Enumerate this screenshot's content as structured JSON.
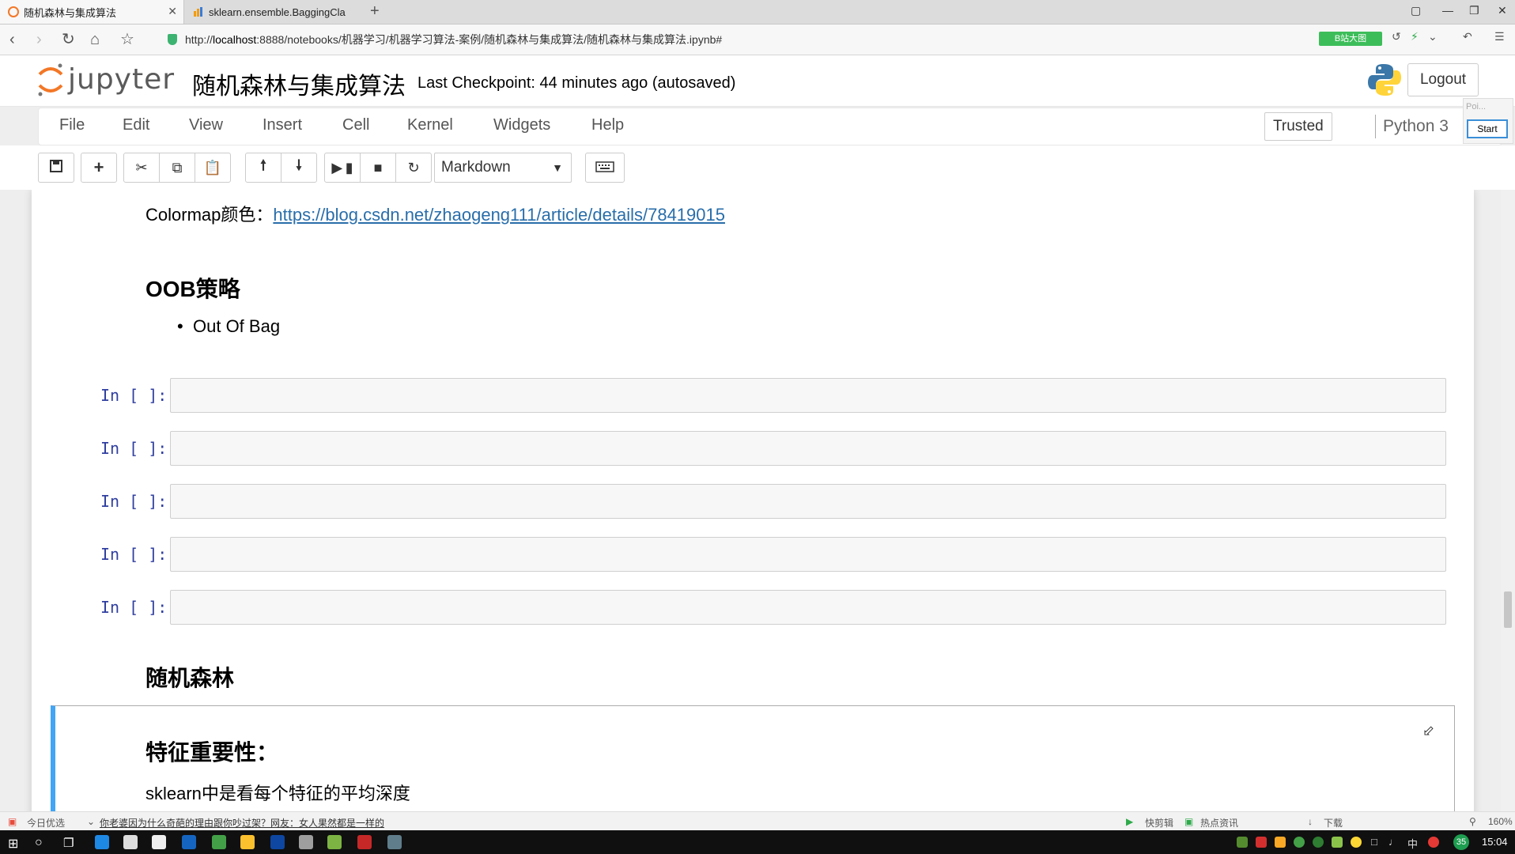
{
  "browser": {
    "tabs": [
      {
        "title": "随机森林与集成算法",
        "active": true
      },
      {
        "title": "sklearn.ensemble.BaggingCla",
        "active": false
      }
    ],
    "url_prefix": "http://",
    "url_host": "localhost",
    "url_rest": ":8888/notebooks/机器学习/机器学习算法-案例/随机森林与集成算法/随机森林与集成算法.ipynb#",
    "badge": "B站大图"
  },
  "jupyter": {
    "logo_text": "jupyter",
    "notebook_name": "随机森林与集成算法",
    "checkpoint": "Last Checkpoint: 44 minutes ago (autosaved)",
    "logout_label": "Logout",
    "menu": [
      "File",
      "Edit",
      "View",
      "Insert",
      "Cell",
      "Kernel",
      "Widgets",
      "Help"
    ],
    "trusted_label": "Trusted",
    "kernel_name": "Python 3",
    "popup_hint": "Poi...",
    "start_label": "Start",
    "cell_type": "Markdown"
  },
  "notebook": {
    "colormap_label": "Colormap颜色：",
    "colormap_link": "https://blog.csdn.net/zhaogeng111/article/details/78419015",
    "oob_heading": "OOB策略",
    "oob_bullet": "Out Of Bag",
    "prompt_label": "In [ ]:",
    "rf_heading": "随机森林",
    "feature_heading": "特征重要性：",
    "feature_text": "sklearn中是看每个特征的平均深度"
  },
  "statusbar": {
    "left_label": "今日优选",
    "news": "你老婆因为什么奇葩的理由跟你吵过架？网友：女人果然都是一样的",
    "quick_clip": "快剪辑",
    "hot_news": "热点资讯",
    "download": "下载",
    "zoom": "160%"
  },
  "taskbar": {
    "time": "15:04",
    "ime": "中",
    "badge_count": "35"
  },
  "colors": {
    "accent_blue": "#42a5f5",
    "prompt_blue": "#303f9f",
    "link": "#296eaa",
    "jupyter_orange": "#f37726"
  }
}
